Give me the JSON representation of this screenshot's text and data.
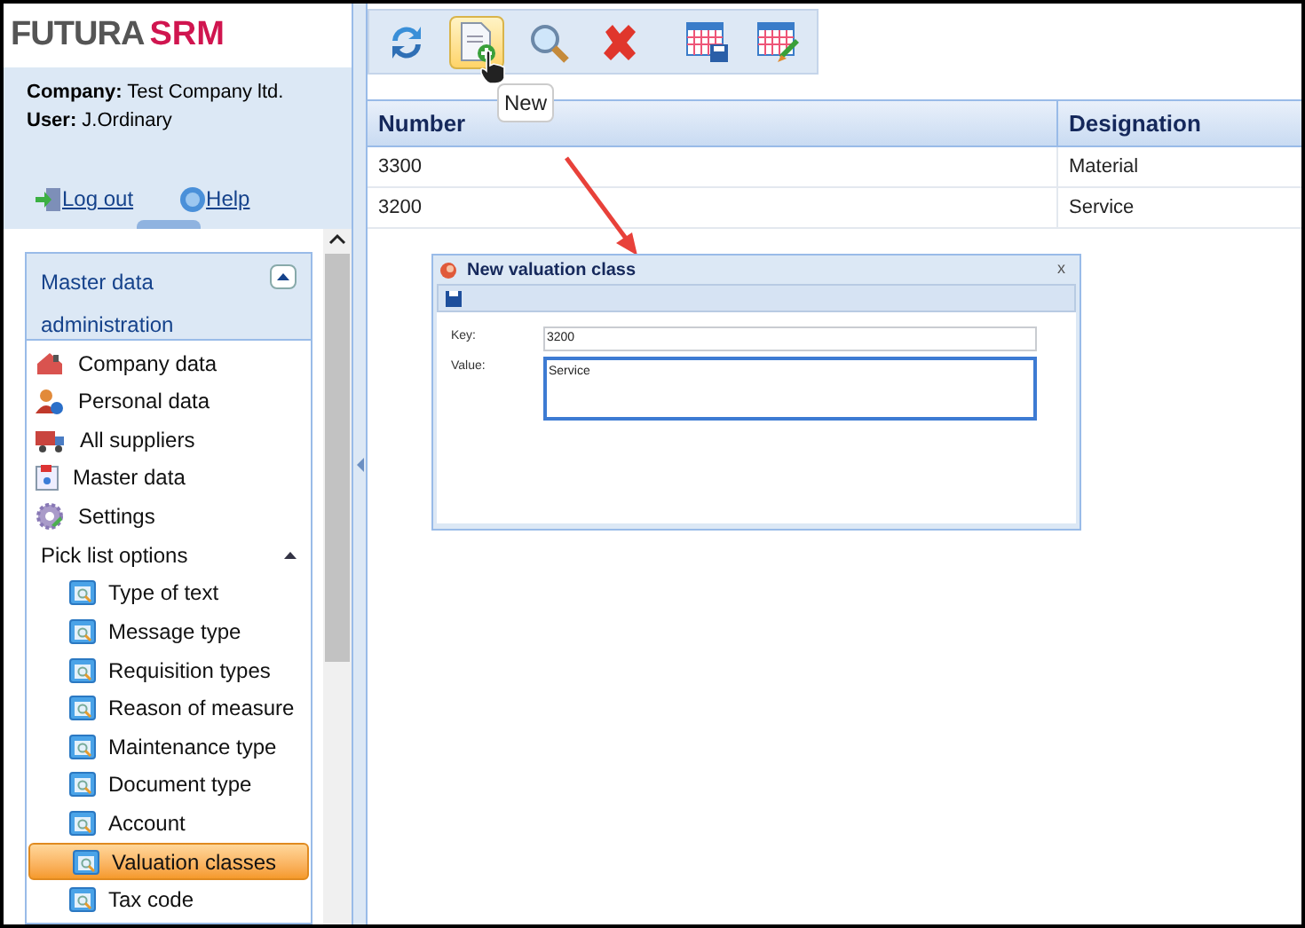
{
  "logo": {
    "part_1": "FUTURA",
    "part_2": "SRM"
  },
  "user_info": {
    "company_label": "Company:",
    "company": "Test Company ltd.",
    "user_label": "User:",
    "user": "J.Ordinary"
  },
  "links": [
    "Log out",
    "Help"
  ],
  "sidebar": {
    "title": "Master data administration",
    "expanded": true,
    "items": [
      {
        "label": "Company data",
        "kind": "link"
      },
      {
        "label": "Personal data",
        "kind": "link"
      },
      {
        "label": "All suppliers",
        "kind": "link"
      },
      {
        "label": "Master data",
        "kind": "link"
      },
      {
        "label": "Settings",
        "kind": "link"
      },
      {
        "label": "Pick list options",
        "kind": "group",
        "expanded": true,
        "children": [
          {
            "label": "Type of text",
            "selected": false
          },
          {
            "label": "Message type",
            "selected": false
          },
          {
            "label": "Requisition types",
            "selected": false
          },
          {
            "label": "Reason of measure",
            "selected": false
          },
          {
            "label": "Maintenance type",
            "selected": false
          },
          {
            "label": "Document type",
            "selected": false
          },
          {
            "label": "Account",
            "selected": false
          },
          {
            "label": "Valuation classes",
            "selected": true
          },
          {
            "label": "Tax code",
            "selected": false
          }
        ]
      }
    ]
  },
  "toolbar": {
    "buttons": [
      {
        "hovered": false
      },
      {
        "hovered": true
      },
      {
        "hovered": false
      },
      {
        "hovered": false
      },
      {
        "hovered": false
      },
      {
        "hovered": false
      }
    ],
    "tooltip": "New"
  },
  "table": {
    "columns": [
      "Number",
      "Designation"
    ],
    "rows": [
      [
        "3300",
        "Material"
      ],
      [
        "3200",
        "Service"
      ]
    ]
  },
  "dialog": {
    "title": "New valuation class",
    "close": "x",
    "fields": [
      {
        "label": "Key:",
        "value": "3200",
        "kind": "text",
        "focused": false
      },
      {
        "label": "Value:",
        "value": "Service",
        "kind": "textarea",
        "focused": true
      }
    ]
  }
}
